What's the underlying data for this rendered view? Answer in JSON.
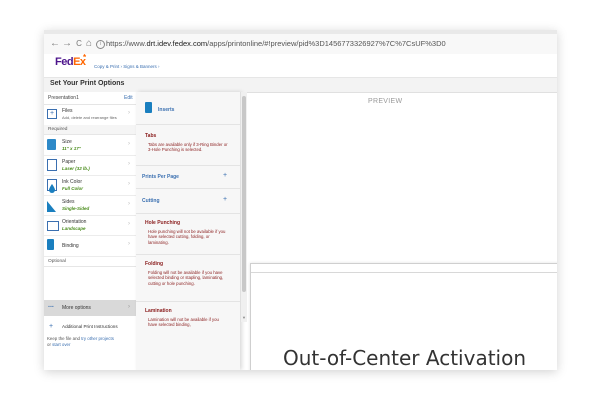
{
  "browser": {
    "back": "←",
    "forward": "→",
    "reload": "C",
    "home": "⌂",
    "url_prefix": "https://www.",
    "url_domain": "drt.idev.fedex.com",
    "url_path": "/apps/printonline/#!preview/pid%3D1456773326927%7C%7CsUF%3D0"
  },
  "header": {
    "logo_fed": "Fed",
    "logo_ex": "Ex",
    "logo_star": "*",
    "breadcrumb": "Copy & Print ›   Signs & Banners ›"
  },
  "subheader": {
    "title": "Set Your Print Options"
  },
  "left_panel": {
    "presentation_name": "Presentation1",
    "edit_label": "Edit",
    "files_label": "Files",
    "files_sub": "Add, delete and rearrange files",
    "required_label": "Required",
    "size_label": "Size",
    "size_value": "11\" x 17\"",
    "paper_label": "Paper",
    "paper_value": "Laser (32 lb.)",
    "ink_label": "Ink Color",
    "ink_value": "Full Color",
    "sides_label": "Sides",
    "sides_value": "Single-Sided",
    "orientation_label": "Orientation",
    "orientation_value": "Landscape",
    "binding_label": "Binding",
    "optional_label": "Optional",
    "more_dots": "...",
    "more_label": "More options",
    "additional_label": "Additional Print Instructions",
    "keep_text": "Keep the file and",
    "keep_link1": "try other projects",
    "keep_or": "or",
    "keep_link2": "start over"
  },
  "flyout": {
    "inserts_label": "Inserts",
    "tabs_label": "Tabs",
    "tabs_note": "Tabs are available only if 3-Ring Binder or 3-Hole Punching is selected.",
    "prints_per_page_label": "Prints Per Page",
    "cutting_label": "Cutting",
    "hole_punching_label": "Hole Punching",
    "hole_punching_note": "Hole punching will not be available if you have selected cutting, folding, or laminating.",
    "folding_label": "Folding",
    "folding_note": "Folding will not be available if you have selected binding or stapling, laminating, cutting or hole punching.",
    "lamination_label": "Lamination",
    "lamination_note": "Lamination will not be available if you have selected binding,",
    "plus": "+"
  },
  "preview": {
    "label": "PREVIEW",
    "document_title": "Out-of-Center Activation"
  },
  "colors": {
    "fedex_purple": "#4d148c",
    "fedex_orange": "#ff6600",
    "link_blue": "#3a6fb0",
    "note_red": "#8a1d1d",
    "value_green": "#4a8c1c"
  }
}
